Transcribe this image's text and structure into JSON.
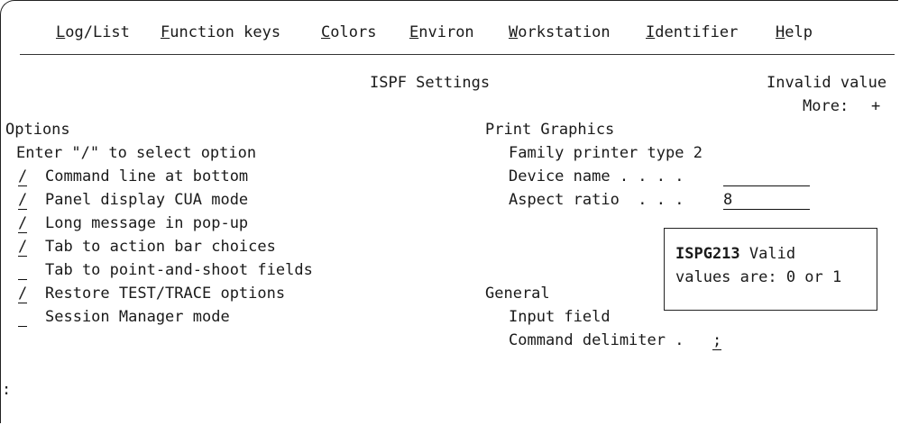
{
  "menubar": {
    "items": [
      {
        "mnemonic": "L",
        "rest": "og/List"
      },
      {
        "mnemonic": "F",
        "rest": "unction keys"
      },
      {
        "mnemonic": "C",
        "rest": "olors"
      },
      {
        "mnemonic": "E",
        "rest": "nviron"
      },
      {
        "mnemonic": "W",
        "rest": "orkstation"
      },
      {
        "mnemonic": "I",
        "rest": "dentifier"
      },
      {
        "mnemonic": "H",
        "rest": "elp"
      }
    ]
  },
  "panel": {
    "title": "ISPF Settings",
    "error": "Invalid value",
    "more_label": "More:",
    "more_indicator": "+"
  },
  "options": {
    "heading": "Options",
    "instruction": "Enter \"/\" to select option",
    "items": [
      {
        "value": "/",
        "label": "Command line at bottom"
      },
      {
        "value": "/",
        "label": "Panel display CUA mode"
      },
      {
        "value": "/",
        "label": "Long message in pop-up"
      },
      {
        "value": "/",
        "label": "Tab to action bar choices"
      },
      {
        "value": "",
        "label": "Tab to point-and-shoot fields"
      },
      {
        "value": "/",
        "label": "Restore TEST/TRACE options"
      },
      {
        "value": "",
        "label": "Session Manager mode"
      }
    ]
  },
  "print_graphics": {
    "heading": "Print Graphics",
    "family_label": "Family printer type 2",
    "device_label": "Device name . . . .",
    "device_value": "",
    "aspect_label": "Aspect ratio  . . .",
    "aspect_value": "8"
  },
  "general": {
    "heading": "General",
    "input_field_label": "Input field",
    "delimiter_label": "Command delimiter .",
    "delimiter_value": ";"
  },
  "popup": {
    "code": "ISPG213",
    "line1_rest": " Valid",
    "line2": "values are: 0 or 1"
  },
  "more_left": ":"
}
